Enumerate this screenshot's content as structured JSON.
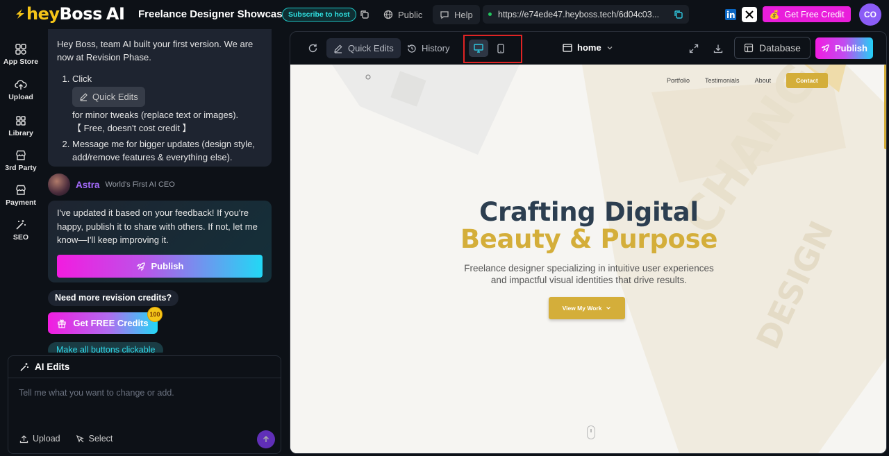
{
  "app": {
    "logo_hey": "hey",
    "logo_boss": "Boss",
    "logo_ai": "AI",
    "project_title": "Freelance Designer Showcase",
    "subscribe_badge": "Subscribe to host",
    "public_label": "Public",
    "help_label": "Help",
    "url": "https://e74ede47.heyboss.tech/6d04c03...",
    "get_credit_label": "Get Free Credit",
    "avatar_initials": "CO"
  },
  "sidebar": {
    "items": [
      {
        "label": "App Store",
        "icon": "app-store-icon"
      },
      {
        "label": "Upload",
        "icon": "cloud-upload-icon"
      },
      {
        "label": "Library",
        "icon": "library-icon"
      },
      {
        "label": "3rd Party",
        "icon": "store-icon"
      },
      {
        "label": "Payment",
        "icon": "payment-icon"
      },
      {
        "label": "SEO",
        "icon": "seo-wand-icon"
      }
    ]
  },
  "chat": {
    "msg1_intro": "Hey Boss, team AI built your first version. We are now at Revision Phase.",
    "step1_prefix": "Click",
    "quick_edits_chip": "Quick Edits",
    "step1_suffix": "for minor tweaks (replace text or images).",
    "step1_note": "【 Free, doesn't cost credit 】",
    "step2": "Message me for bigger updates (design style, add/remove features & everything else).",
    "astra_name": "Astra",
    "astra_title": "World's First AI CEO",
    "msg2": "I've updated it based on your feedback! If you're happy, publish it to share with others. If not, let me know—I'll keep improving it.",
    "publish_label": "Publish",
    "need_more": "Need more revision credits?",
    "free_credits_label": "Get FREE Credits",
    "free_credits_badge": "100",
    "suggestion": "Make all buttons clickable"
  },
  "ai_edits": {
    "title": "AI Edits",
    "placeholder": "Tell me what you want to change or add.",
    "upload_label": "Upload",
    "select_label": "Select"
  },
  "preview_toolbar": {
    "quick_edits_label": "Quick Edits",
    "history_label": "History",
    "page_label": "home",
    "database_label": "Database",
    "publish_label": "Publish",
    "active_device": "desktop"
  },
  "site": {
    "nav": [
      "Portfolio",
      "Testimonials",
      "About"
    ],
    "contact_label": "Contact",
    "hero_line1": "Crafting Digital",
    "hero_line2": "Beauty & Purpose",
    "hero_sub": "Freelance designer specializing in intuitive user experiences and impactful visual identities that drive results.",
    "cta_label": "View My Work",
    "accent": "#d4ae3a",
    "heading_color": "#2c3e50"
  }
}
